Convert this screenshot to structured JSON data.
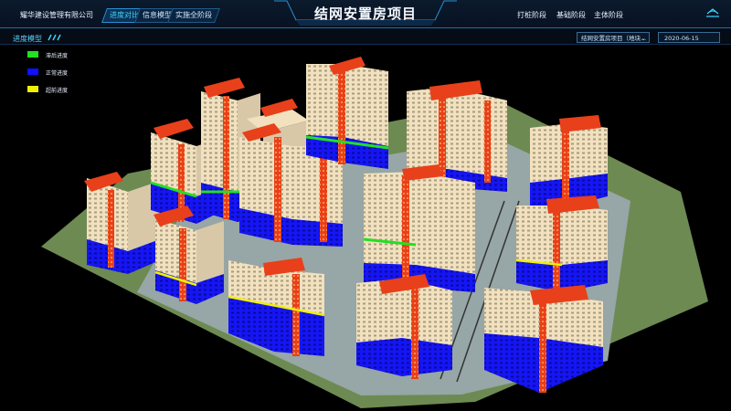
{
  "header": {
    "company": "耀华建设管理有限公司",
    "tabs": [
      {
        "label": "进度对比",
        "active": true
      },
      {
        "label": "信息模型",
        "active": false
      },
      {
        "label": "实施全阶段",
        "active": false
      }
    ],
    "title": "结网安置房项目",
    "right_tabs": [
      "打桩阶段",
      "基础阶段",
      "主体阶段"
    ]
  },
  "panel": {
    "label": "进度模型",
    "project_select": "结网安置房项目（地块...",
    "date": "2020-06-15"
  },
  "legend": [
    {
      "label": "滞后进度",
      "color": "#22e022"
    },
    {
      "label": "正常进度",
      "color": "#1010ff"
    },
    {
      "label": "超前进度",
      "color": "#f0f000"
    }
  ],
  "colors": {
    "accent": "#38d7ff",
    "facade": "#f2e2c0",
    "orange_strip": "#e8401a",
    "normal": "#1010ff",
    "behind": "#22e022",
    "ahead": "#f0f000"
  }
}
